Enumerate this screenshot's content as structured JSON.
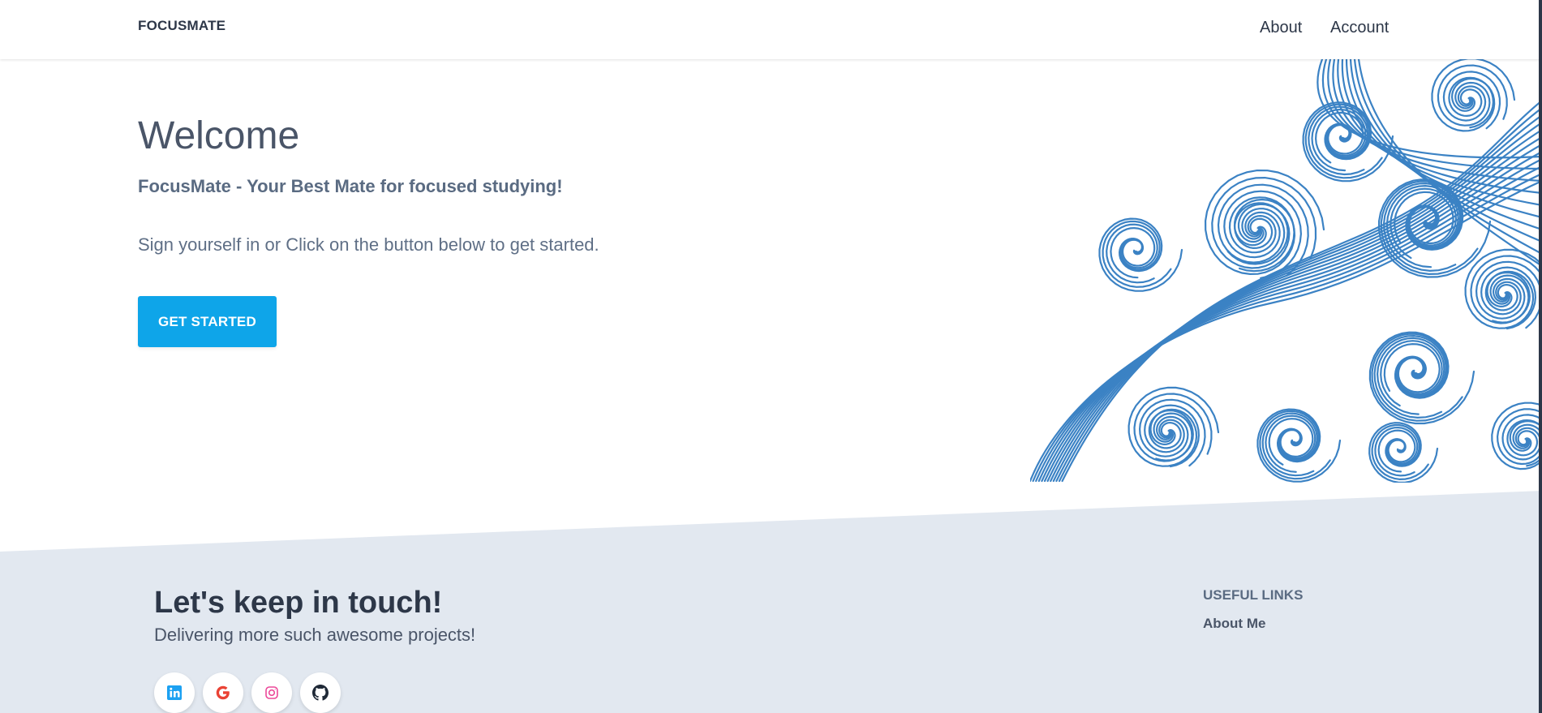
{
  "navbar": {
    "brand": "FOCUSMATE",
    "links": [
      {
        "label": "About"
      },
      {
        "label": "Account"
      }
    ]
  },
  "hero": {
    "title": "Welcome",
    "subtitle": "FocusMate - Your Best Mate for focused studying!",
    "lead": "Sign yourself in or Click on the button below to get started.",
    "cta_label": "GET STARTED"
  },
  "footer": {
    "title": "Let's keep in touch!",
    "subtitle": "Delivering more such awesome projects!",
    "social": [
      {
        "icon": "linkedin-icon",
        "color": "#1ca1f2"
      },
      {
        "icon": "google-icon",
        "color": "#ea4335"
      },
      {
        "icon": "instagram-icon",
        "color": "#ec4899"
      },
      {
        "icon": "github-icon",
        "color": "#1f2937"
      }
    ],
    "useful_links": {
      "heading": "USEFUL LINKS",
      "items": [
        {
          "label": "About Me"
        }
      ]
    }
  },
  "colors": {
    "accent": "#0ea5e9",
    "footer_bg": "#e2e8f0",
    "text_dark": "#2d3748",
    "wave": "#3b82c4"
  }
}
